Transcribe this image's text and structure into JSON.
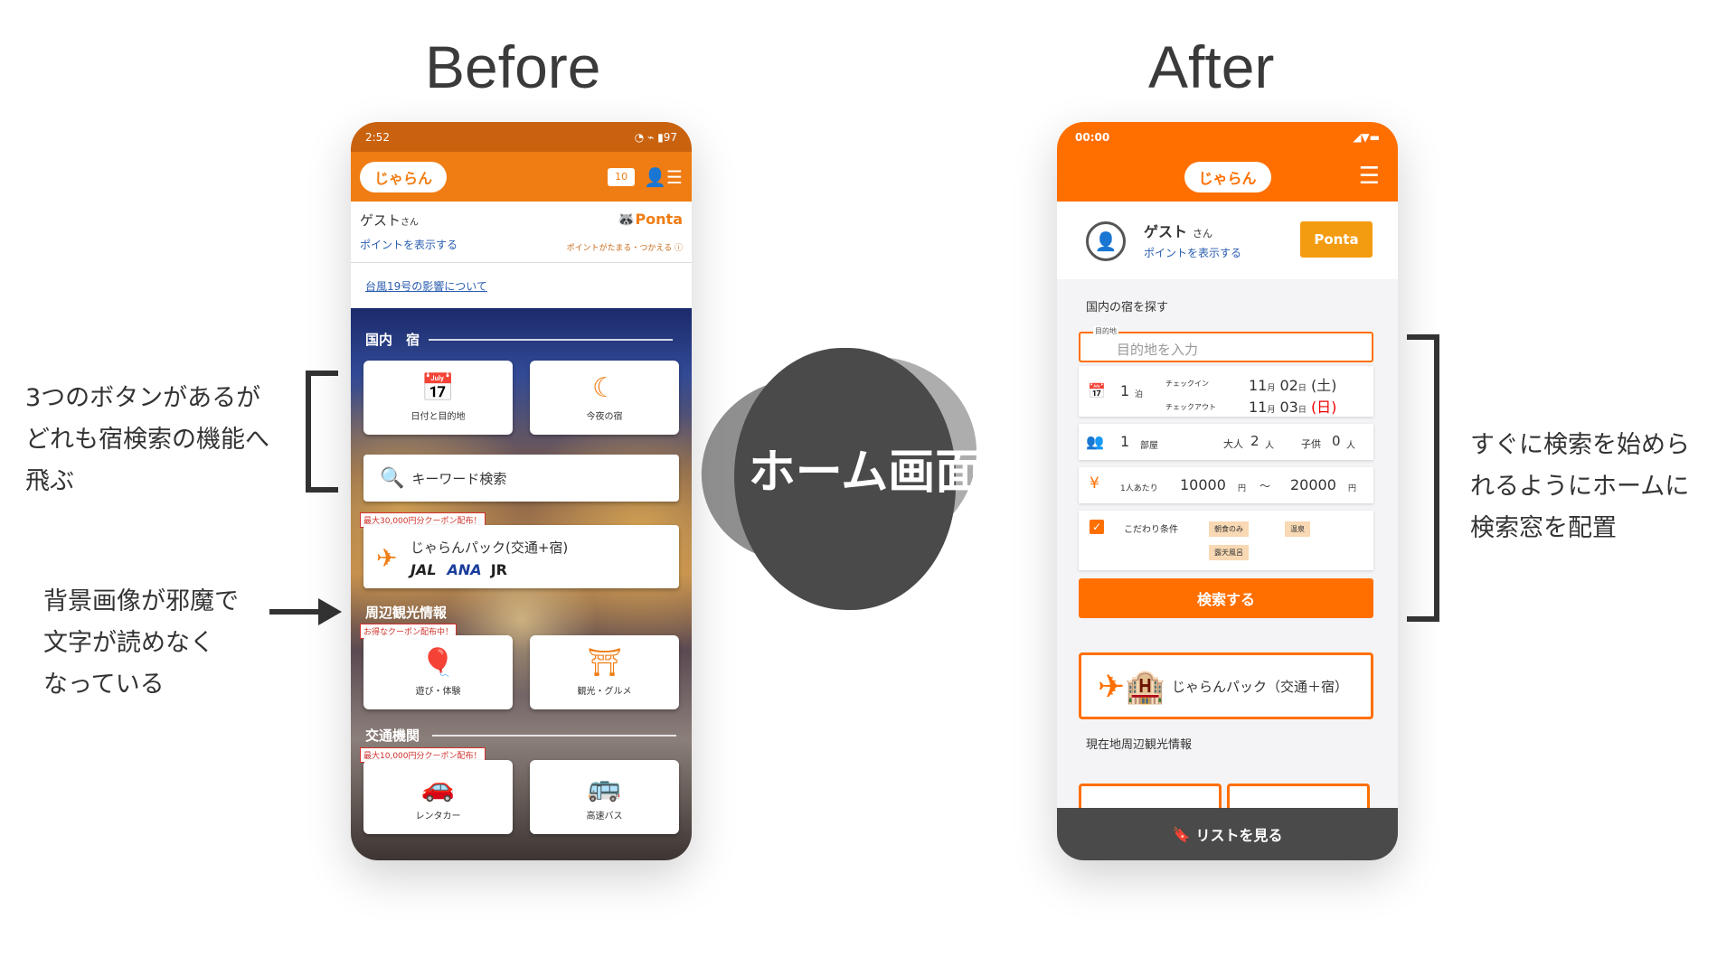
{
  "headings": {
    "before": "Before",
    "after": "After"
  },
  "center_label": "ホーム画面",
  "annotations": {
    "left_top": [
      "3つのボタンがあるが",
      "どれも宿検索の機能へ",
      "飛ぶ"
    ],
    "left_bottom": [
      "背景画像が邪魔で",
      "文字が読めなく",
      "なっている"
    ],
    "right": [
      "すぐに検索を始めら",
      "れるようにホームに",
      "検索窓を配置"
    ]
  },
  "before": {
    "status_time": "2:52",
    "status_battery": "97",
    "logo_text": "じゃらん",
    "message_count": "10",
    "guest_name": "ゲスト",
    "guest_suffix": "さん",
    "points_link": "ポイントを表示する",
    "ponta_label": "Ponta",
    "ponta_sub": "ポイントがたまる・つかえる",
    "notice_link": "台風19号の影響について",
    "section_domestic": "国内　宿",
    "btn_date_dest": "日付と目的地",
    "btn_tonight": "今夜の宿",
    "keyword_search": "キーワード検索",
    "coupon_pack": "最大30,000円分クーポン配布！",
    "pack_title": "じゃらんパック(交通+宿)",
    "carrier_jal": "JAL",
    "carrier_ana": "ANA",
    "carrier_jr": "JR",
    "section_sightseeing": "周辺観光情報",
    "coupon_sight": "お得なクーポン配布中！",
    "btn_play": "遊び・体験",
    "btn_gourmet": "観光・グルメ",
    "section_transport": "交通機関",
    "coupon_transport": "最大10,000円分クーポン配布！",
    "btn_rentacar": "レンタカー",
    "btn_bus": "高速バス"
  },
  "after": {
    "status_time": "00:00",
    "logo_text": "じゃらん",
    "guest_name": "ゲスト",
    "guest_suffix": "さん",
    "points_link": "ポイントを表示する",
    "ponta_label": "Ponta",
    "section_domestic": "国内の宿を探す",
    "dest_label": "目的地",
    "dest_placeholder": "目的地を入力",
    "nights": "1",
    "nights_unit": "泊",
    "checkin_label": "チェックイン",
    "checkout_label": "チェックアウト",
    "checkin_month": "11",
    "checkin_day": "02",
    "checkin_dow": "(土)",
    "checkout_month": "11",
    "checkout_day": "03",
    "checkout_dow": "(日)",
    "month_unit": "月",
    "day_unit": "日",
    "rooms": "1",
    "rooms_unit": "部屋",
    "adults_label": "大人",
    "adults": "2",
    "children_label": "子供",
    "children": "0",
    "people_unit": "人",
    "yen_symbol": "¥",
    "per_person": "1人あたり",
    "price_min": "10000",
    "price_max": "20000",
    "yen_unit": "円",
    "tilde": "～",
    "conditions_label": "こだわり条件",
    "tags": [
      "朝食のみ",
      "温泉",
      "露天風呂"
    ],
    "search_button": "検索する",
    "pack_button": "じゃらんパック（交通＋宿）",
    "section_nearby": "現在地周辺観光情報",
    "list_button": "リストを見る"
  },
  "colors": {
    "before_orange": "#f07d14",
    "after_orange": "#ff6f00",
    "blob_dark": "#4a4a4a"
  }
}
